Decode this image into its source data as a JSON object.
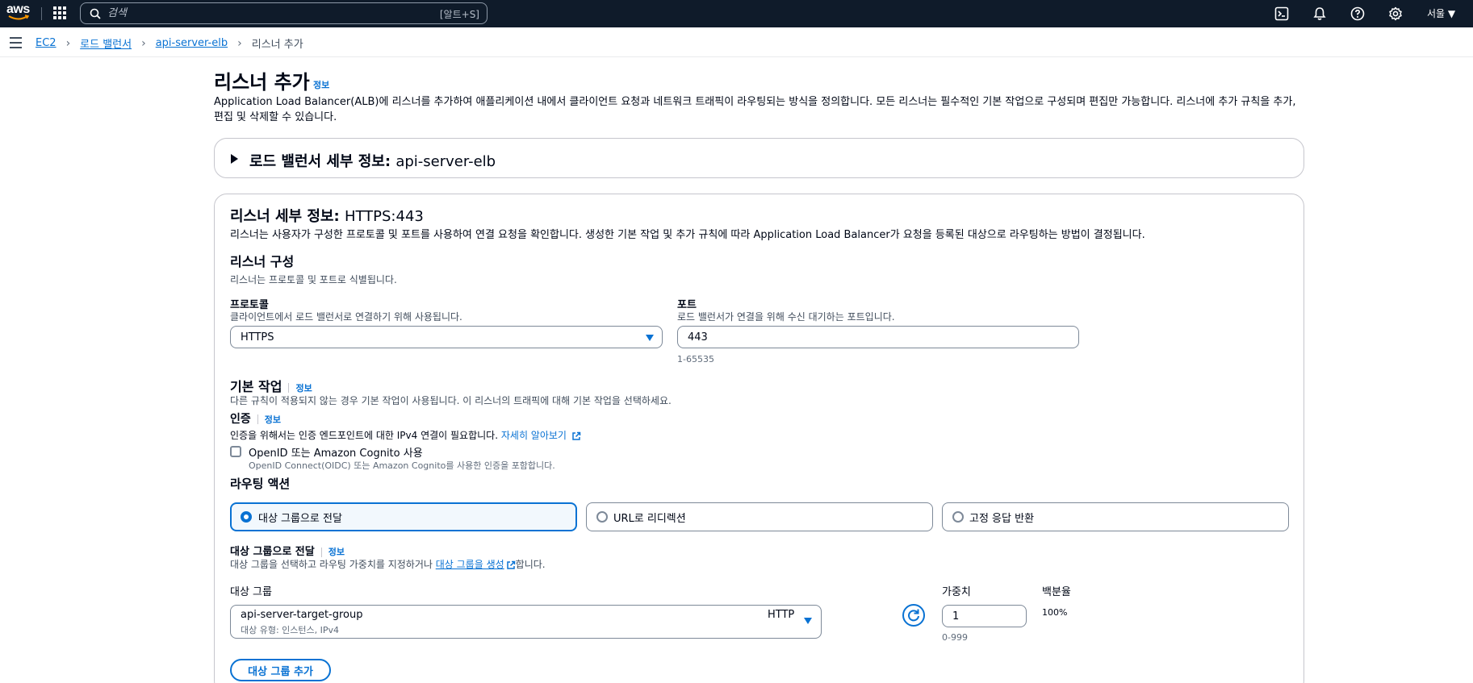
{
  "topnav": {
    "logo_text": "aws",
    "search_placeholder": "검색",
    "search_shortcut": "[알트+S]",
    "region": "서울 ▼"
  },
  "breadcrumb": {
    "items": [
      "EC2",
      "로드 밸런서",
      "api-server-elb",
      "리스너 추가"
    ]
  },
  "page": {
    "title": "리스너 추가",
    "info": "정보",
    "description": "Application Load Balancer(ALB)에 리스너를 추가하여 애플리케이션 내에서 클라이언트 요청과 네트워크 트래픽이 라우팅되는 방식을 정의합니다. 모든 리스너는 필수적인 기본 작업으로 구성되며 편집만 가능합니다. 리스너에 추가 규칙을 추가, 편집 및 삭제할 수 있습니다."
  },
  "lb_details": {
    "heading": "로드 밸런서 세부 정보:",
    "name": "api-server-elb"
  },
  "listener": {
    "heading": "리스너 세부 정보:",
    "value": "HTTPS:443",
    "description": "리스너는 사용자가 구성한 프로토콜 및 포트를 사용하여 연결 요청을 확인합니다. 생성한 기본 작업 및 추가 규칙에 따라 Application Load Balancer가 요청을 등록된 대상으로 라우팅하는 방법이 결정됩니다.",
    "config_heading": "리스너 구성",
    "config_desc": "리스너는 프로토콜 및 포트로 식별됩니다.",
    "protocol_label": "프로토콜",
    "protocol_desc": "클라이언트에서 로드 밸런서로 연결하기 위해 사용됩니다.",
    "protocol_value": "HTTPS",
    "port_label": "포트",
    "port_desc": "로드 밸런서가 연결을 위해 수신 대기하는 포트입니다.",
    "port_value": "443",
    "port_hint": "1-65535"
  },
  "default_action": {
    "heading": "기본 작업",
    "info": "정보",
    "desc": "다른 규칙이 적용되지 않는 경우 기본 작업이 사용됩니다. 이 리스너의 트래픽에 대해 기본 작업을 선택하세요.",
    "auth_heading": "인증",
    "auth_info": "정보",
    "auth_desc": "인증을 위해서는 인증 엔드포인트에 대한 IPv4 연결이 필요합니다.",
    "auth_learn_more": "자세히 알아보기",
    "oidc_label": "OpenID 또는 Amazon Cognito 사용",
    "oidc_desc": "OpenID Connect(OIDC) 또는 Amazon Cognito를 사용한 인증을 포함합니다.",
    "routing_heading": "라우팅 액션",
    "routing_options": [
      "대상 그룹으로 전달",
      "URL로 리디렉션",
      "고정 응답 반환"
    ],
    "forward_heading": "대상 그룹으로 전달",
    "forward_info": "정보",
    "forward_desc_pre": "대상 그룹을 선택하고 라우팅 가중치를 지정하거나 ",
    "forward_desc_link": "대상 그룹을 생성",
    "forward_desc_post": "합니다.",
    "tg_label": "대상 그룹",
    "tg_name": "api-server-target-group",
    "tg_type": "대상 유형: 인스턴스, IPv4",
    "tg_protocol": "HTTP",
    "weight_label": "가중치",
    "weight_value": "1",
    "weight_hint": "0-999",
    "percent_label": "백분율",
    "percent_value": "100%",
    "add_tg_button": "대상 그룹 추가"
  }
}
